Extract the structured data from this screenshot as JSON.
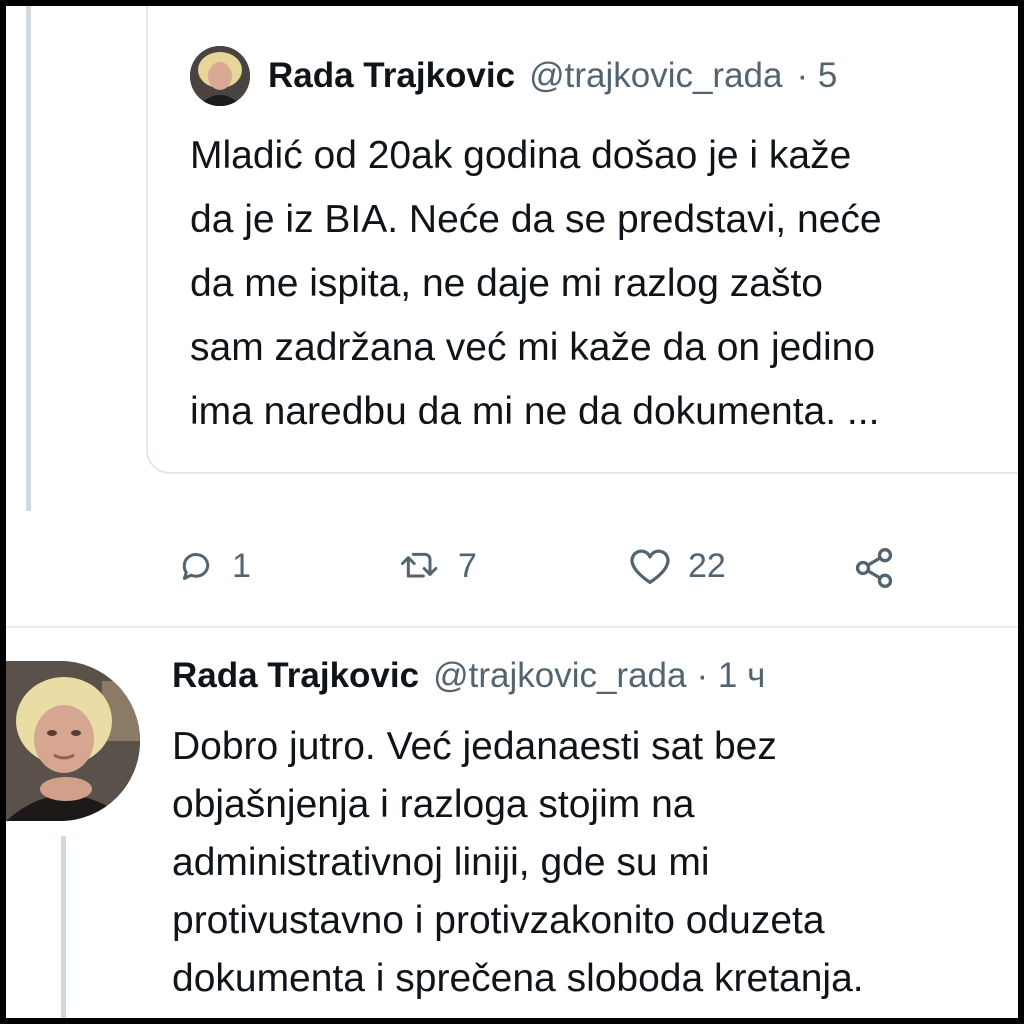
{
  "quoted_tweet": {
    "author_name": "Rada Trajkovic",
    "handle": "@trajkovic_rada",
    "time": "· 5",
    "text": "Mladić od 20ak godina došao je i kaže\nda je iz BIA. Neće da se predstavi, neće\nda me ispita, ne daje mi razlog zašto\nsam zadržana već mi kaže da on jedino\nima naredbu da mi ne da dokumenta. ..."
  },
  "actions": {
    "reply_count": "1",
    "retweet_count": "7",
    "like_count": "22",
    "icons": [
      "reply-icon",
      "retweet-icon",
      "like-icon",
      "share-icon"
    ]
  },
  "reply_tweet": {
    "author_name": "Rada Trajkovic",
    "handle": "@trajkovic_rada",
    "time": "· 1 ч",
    "text": "Dobro jutro. Već jedanaesti sat bez\nobjašnjenja i razloga stojim na\nadministrativnoj liniji, gde su mi\nprotivustavno i protivzakonito oduzeta\ndokumenta i sprečena sloboda kretanja."
  },
  "colors": {
    "text": "#0f1419",
    "secondary": "#536471",
    "border": "#e3e8ec",
    "thread_line": "#cfd9de"
  }
}
